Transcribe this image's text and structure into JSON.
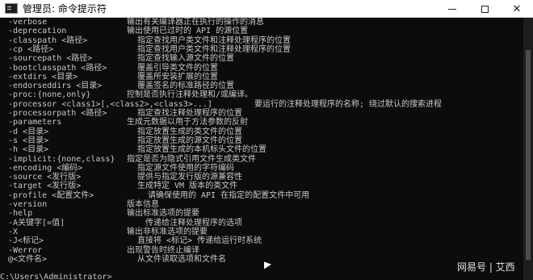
{
  "window": {
    "title": "管理员: 命令提示符",
    "min_icon": "minimize-icon",
    "max_icon": "maximize-icon",
    "close_icon": "close-icon",
    "close_glyph": "✕"
  },
  "options": [
    {
      "opt": "-verbose",
      "desc": "输出有关编译器正在执行的操作的消息"
    },
    {
      "opt": "-deprecation",
      "desc": "输出使用已过时的 API 的源位置"
    },
    {
      "opt": "-classpath <路径>",
      "desc": "指定查找用户类文件和注释处理程序的位置"
    },
    {
      "opt": "-cp <路径>",
      "desc": "指定查找用户类文件和注释处理程序的位置"
    },
    {
      "opt": "-sourcepath <路径>",
      "desc": "指定查找输入源文件的位置"
    },
    {
      "opt": "-bootclasspath <路径>",
      "desc": "覆盖引导类文件的位置"
    },
    {
      "opt": "-extdirs <目录>",
      "desc": "覆盖所安装扩展的位置"
    },
    {
      "opt": "-endorseddirs <目录>",
      "desc": "覆盖签名的标准路径的位置"
    },
    {
      "opt": "-proc:{none,only}",
      "desc": "控制是否执行注释处理和/或编译。"
    },
    {
      "opt": "-processor <class1>[,<class2>,<class3>...]",
      "desc": "要运行的注释处理程序的名称; 绕过默认的搜索进程"
    },
    {
      "opt": "-processorpath <路径>",
      "desc": "指定查找注释处理程序的位置"
    },
    {
      "opt": "-parameters",
      "desc": "生成元数据以用于方法参数的反射"
    },
    {
      "opt": "-d <目录>",
      "desc": "指定放置生成的类文件的位置"
    },
    {
      "opt": "-s <目录>",
      "desc": "指定放置生成的源文件的位置"
    },
    {
      "opt": "-h <目录>",
      "desc": "指定放置生成的本机标头文件的位置"
    },
    {
      "opt": "-implicit:{none,class}",
      "desc": "指定是否为隐式引用文件生成类文件"
    },
    {
      "opt": "-encoding <编码>",
      "desc": "指定源文件使用的字符编码"
    },
    {
      "opt": "-source <发行版>",
      "desc": "提供与指定发行版的源兼容性"
    },
    {
      "opt": "-target <发行版>",
      "desc": "生成特定 VM 版本的类文件"
    },
    {
      "opt": "-profile <配置文件>",
      "desc": "请确保使用的 API 在指定的配置文件中可用"
    },
    {
      "opt": "-version",
      "desc": "版本信息"
    },
    {
      "opt": "-help",
      "desc": "输出标准选项的提要"
    },
    {
      "opt": "-A关键字[=值]",
      "desc": "传递给注释处理程序的选项"
    },
    {
      "opt": "-X",
      "desc": "输出非标准选项的提要"
    },
    {
      "opt": "-J<标记>",
      "desc": "直接将 <标记> 传递给运行时系统"
    },
    {
      "opt": "-Werror",
      "desc": "出现警告时终止编译"
    },
    {
      "opt": "@<文件名>",
      "desc": "从文件读取选项和文件名"
    }
  ],
  "prompt": "C:\\Users\\Administrator>",
  "watermark": "网易号 | 艾西"
}
